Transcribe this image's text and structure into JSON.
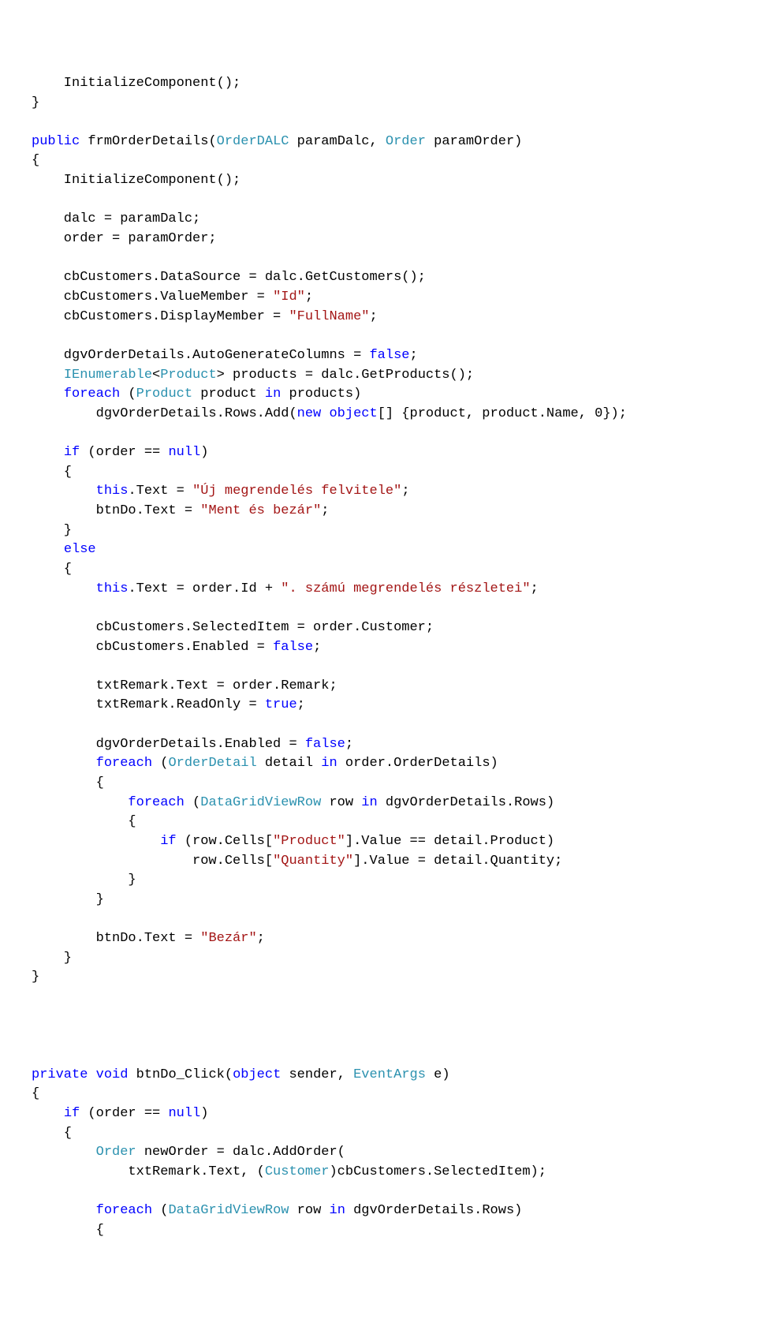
{
  "lines": [
    [
      [
        "n",
        "    InitializeComponent();"
      ]
    ],
    [
      [
        "n",
        "}"
      ]
    ],
    [
      [
        "n",
        ""
      ]
    ],
    [
      [
        "k",
        "public"
      ],
      [
        "n",
        " frmOrderDetails("
      ],
      [
        "t",
        "OrderDALC"
      ],
      [
        "n",
        " paramDalc, "
      ],
      [
        "t",
        "Order"
      ],
      [
        "n",
        " paramOrder)"
      ]
    ],
    [
      [
        "n",
        "{"
      ]
    ],
    [
      [
        "n",
        "    InitializeComponent();"
      ]
    ],
    [
      [
        "n",
        ""
      ]
    ],
    [
      [
        "n",
        "    dalc = paramDalc;"
      ]
    ],
    [
      [
        "n",
        "    order = paramOrder;"
      ]
    ],
    [
      [
        "n",
        ""
      ]
    ],
    [
      [
        "n",
        "    cbCustomers.DataSource = dalc.GetCustomers();"
      ]
    ],
    [
      [
        "n",
        "    cbCustomers.ValueMember = "
      ],
      [
        "s",
        "\"Id\""
      ],
      [
        "n",
        ";"
      ]
    ],
    [
      [
        "n",
        "    cbCustomers.DisplayMember = "
      ],
      [
        "s",
        "\"FullName\""
      ],
      [
        "n",
        ";"
      ]
    ],
    [
      [
        "n",
        ""
      ]
    ],
    [
      [
        "n",
        "    dgvOrderDetails.AutoGenerateColumns = "
      ],
      [
        "k",
        "false"
      ],
      [
        "n",
        ";"
      ]
    ],
    [
      [
        "n",
        "    "
      ],
      [
        "t",
        "IEnumerable"
      ],
      [
        "n",
        "<"
      ],
      [
        "t",
        "Product"
      ],
      [
        "n",
        "> products = dalc.GetProducts();"
      ]
    ],
    [
      [
        "n",
        "    "
      ],
      [
        "k",
        "foreach"
      ],
      [
        "n",
        " ("
      ],
      [
        "t",
        "Product"
      ],
      [
        "n",
        " product "
      ],
      [
        "k",
        "in"
      ],
      [
        "n",
        " products)"
      ]
    ],
    [
      [
        "n",
        "        dgvOrderDetails.Rows.Add("
      ],
      [
        "k",
        "new"
      ],
      [
        "n",
        " "
      ],
      [
        "k",
        "object"
      ],
      [
        "n",
        "[] {product, product.Name, 0});"
      ]
    ],
    [
      [
        "n",
        ""
      ]
    ],
    [
      [
        "n",
        "    "
      ],
      [
        "k",
        "if"
      ],
      [
        "n",
        " (order == "
      ],
      [
        "k",
        "null"
      ],
      [
        "n",
        ")"
      ]
    ],
    [
      [
        "n",
        "    {"
      ]
    ],
    [
      [
        "n",
        "        "
      ],
      [
        "k",
        "this"
      ],
      [
        "n",
        ".Text = "
      ],
      [
        "s",
        "\"Új megrendelés felvitele\""
      ],
      [
        "n",
        ";"
      ]
    ],
    [
      [
        "n",
        "        btnDo.Text = "
      ],
      [
        "s",
        "\"Ment és bezár\""
      ],
      [
        "n",
        ";"
      ]
    ],
    [
      [
        "n",
        "    }"
      ]
    ],
    [
      [
        "n",
        "    "
      ],
      [
        "k",
        "else"
      ]
    ],
    [
      [
        "n",
        "    {"
      ]
    ],
    [
      [
        "n",
        "        "
      ],
      [
        "k",
        "this"
      ],
      [
        "n",
        ".Text = order.Id + "
      ],
      [
        "s",
        "\". számú megrendelés részletei\""
      ],
      [
        "n",
        ";"
      ]
    ],
    [
      [
        "n",
        ""
      ]
    ],
    [
      [
        "n",
        "        cbCustomers.SelectedItem = order.Customer;"
      ]
    ],
    [
      [
        "n",
        "        cbCustomers.Enabled = "
      ],
      [
        "k",
        "false"
      ],
      [
        "n",
        ";"
      ]
    ],
    [
      [
        "n",
        ""
      ]
    ],
    [
      [
        "n",
        "        txtRemark.Text = order.Remark;"
      ]
    ],
    [
      [
        "n",
        "        txtRemark.ReadOnly = "
      ],
      [
        "k",
        "true"
      ],
      [
        "n",
        ";"
      ]
    ],
    [
      [
        "n",
        ""
      ]
    ],
    [
      [
        "n",
        "        dgvOrderDetails.Enabled = "
      ],
      [
        "k",
        "false"
      ],
      [
        "n",
        ";"
      ]
    ],
    [
      [
        "n",
        "        "
      ],
      [
        "k",
        "foreach"
      ],
      [
        "n",
        " ("
      ],
      [
        "t",
        "OrderDetail"
      ],
      [
        "n",
        " detail "
      ],
      [
        "k",
        "in"
      ],
      [
        "n",
        " order.OrderDetails)"
      ]
    ],
    [
      [
        "n",
        "        {"
      ]
    ],
    [
      [
        "n",
        "            "
      ],
      [
        "k",
        "foreach"
      ],
      [
        "n",
        " ("
      ],
      [
        "t",
        "DataGridViewRow"
      ],
      [
        "n",
        " row "
      ],
      [
        "k",
        "in"
      ],
      [
        "n",
        " dgvOrderDetails.Rows)"
      ]
    ],
    [
      [
        "n",
        "            {"
      ]
    ],
    [
      [
        "n",
        "                "
      ],
      [
        "k",
        "if"
      ],
      [
        "n",
        " (row.Cells["
      ],
      [
        "s",
        "\"Product\""
      ],
      [
        "n",
        "].Value == detail.Product)"
      ]
    ],
    [
      [
        "n",
        "                    row.Cells["
      ],
      [
        "s",
        "\"Quantity\""
      ],
      [
        "n",
        "].Value = detail.Quantity;"
      ]
    ],
    [
      [
        "n",
        "            }"
      ]
    ],
    [
      [
        "n",
        "        }"
      ]
    ],
    [
      [
        "n",
        ""
      ]
    ],
    [
      [
        "n",
        "        btnDo.Text = "
      ],
      [
        "s",
        "\"Bezár\""
      ],
      [
        "n",
        ";"
      ]
    ],
    [
      [
        "n",
        "    }"
      ]
    ],
    [
      [
        "n",
        "}"
      ]
    ],
    [
      [
        "n",
        ""
      ]
    ],
    [
      [
        "n",
        ""
      ]
    ],
    [
      [
        "n",
        ""
      ]
    ],
    [
      [
        "n",
        ""
      ]
    ],
    [
      [
        "k",
        "private"
      ],
      [
        "n",
        " "
      ],
      [
        "k",
        "void"
      ],
      [
        "n",
        " btnDo_Click("
      ],
      [
        "k",
        "object"
      ],
      [
        "n",
        " sender, "
      ],
      [
        "t",
        "EventArgs"
      ],
      [
        "n",
        " e)"
      ]
    ],
    [
      [
        "n",
        "{"
      ]
    ],
    [
      [
        "n",
        "    "
      ],
      [
        "k",
        "if"
      ],
      [
        "n",
        " (order == "
      ],
      [
        "k",
        "null"
      ],
      [
        "n",
        ")"
      ]
    ],
    [
      [
        "n",
        "    {"
      ]
    ],
    [
      [
        "n",
        "        "
      ],
      [
        "t",
        "Order"
      ],
      [
        "n",
        " newOrder = dalc.AddOrder("
      ]
    ],
    [
      [
        "n",
        "            txtRemark.Text, ("
      ],
      [
        "t",
        "Customer"
      ],
      [
        "n",
        ")cbCustomers.SelectedItem);"
      ]
    ],
    [
      [
        "n",
        ""
      ]
    ],
    [
      [
        "n",
        "        "
      ],
      [
        "k",
        "foreach"
      ],
      [
        "n",
        " ("
      ],
      [
        "t",
        "DataGridViewRow"
      ],
      [
        "n",
        " row "
      ],
      [
        "k",
        "in"
      ],
      [
        "n",
        " dgvOrderDetails.Rows)"
      ]
    ],
    [
      [
        "n",
        "        {"
      ]
    ]
  ]
}
